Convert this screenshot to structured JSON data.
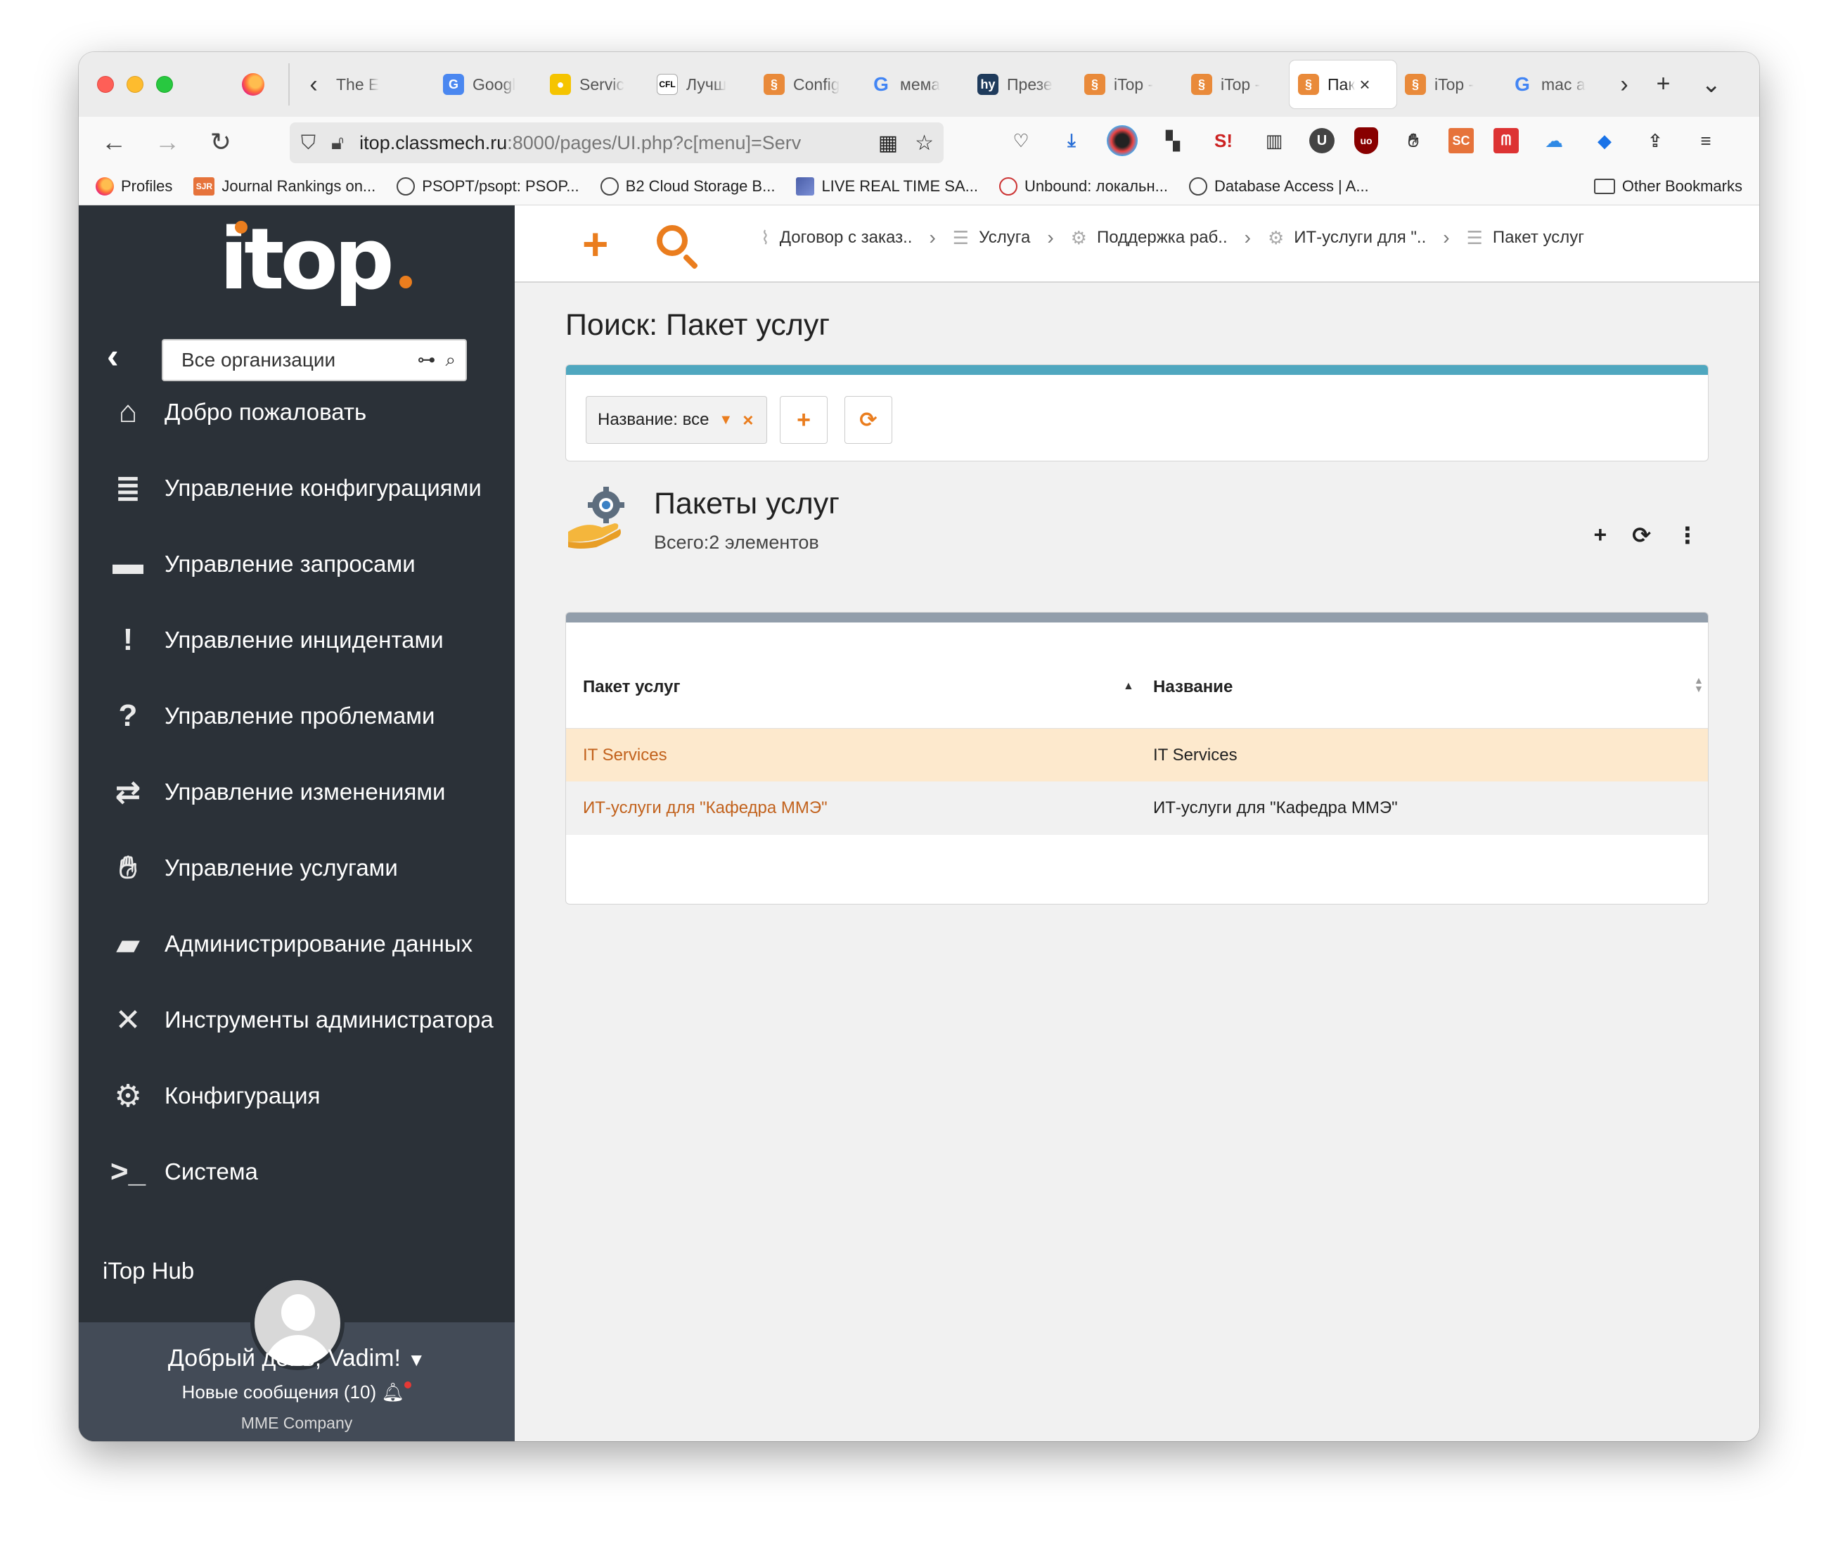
{
  "browser": {
    "tabs": [
      {
        "label": "The E",
        "icon": "text"
      },
      {
        "label": "Googl",
        "icon": "google-translate"
      },
      {
        "label": "Servic",
        "icon": "service"
      },
      {
        "label": "Лучш",
        "icon": "cfl"
      },
      {
        "label": "Config",
        "icon": "itop"
      },
      {
        "label": "мема",
        "icon": "google"
      },
      {
        "label": "Презе",
        "icon": "hy"
      },
      {
        "label": "iTop -",
        "icon": "itop"
      },
      {
        "label": "iTop -",
        "icon": "itop"
      },
      {
        "label": "Пак",
        "icon": "itop",
        "active": true
      },
      {
        "label": "iTop -",
        "icon": "itop"
      },
      {
        "label": "mac a",
        "icon": "google"
      }
    ],
    "url": {
      "host": "itop.classmech.ru",
      "rest": ":8000/pages/UI.php?c[menu]=Serv"
    },
    "bookmarks": [
      {
        "label": "Profiles",
        "icon": "firefox"
      },
      {
        "label": "Journal Rankings on...",
        "icon": "sjr"
      },
      {
        "label": "PSOPT/psopt: PSOP...",
        "icon": "globe"
      },
      {
        "label": "B2 Cloud Storage B...",
        "icon": "globe"
      },
      {
        "label": "LIVE REAL TIME SA...",
        "icon": "live"
      },
      {
        "label": "Unbound: локальн...",
        "icon": "debian"
      },
      {
        "label": "Database Access | A...",
        "icon": "globe"
      }
    ],
    "other_bookmarks": "Other Bookmarks",
    "extensions": [
      "pocket-icon",
      "download-icon",
      "camera-icon",
      "grid-icon",
      "s-icon",
      "fence-icon",
      "u-icon",
      "ublock-icon",
      "gnome-icon",
      "sc-icon",
      "mendeley-icon",
      "cloud-icon",
      "diamond-icon",
      "share-icon",
      "menu-icon"
    ],
    "sjr_text": "SJR",
    "sc_text": "SC",
    "u_text": "U",
    "s_text": "S!",
    "ub_text": "uo"
  },
  "sidebar": {
    "logo": "itop",
    "org_select": "Все организации",
    "menu": [
      {
        "label": "Добро пожаловать",
        "icon": "home-icon"
      },
      {
        "label": "Управление конфигурациями",
        "icon": "database-icon"
      },
      {
        "label": "Управление запросами",
        "icon": "comment-icon"
      },
      {
        "label": "Управление инцидентами",
        "icon": "exclamation-icon"
      },
      {
        "label": "Управление проблемами",
        "icon": "question-icon"
      },
      {
        "label": "Управление изменениями",
        "icon": "exchange-icon"
      },
      {
        "label": "Управление услугами",
        "icon": "handshake-icon"
      },
      {
        "label": "Администрирование данных",
        "icon": "folder-icon"
      },
      {
        "label": "Инструменты администратора",
        "icon": "tools-icon"
      },
      {
        "label": "Конфигурация",
        "icon": "gear-icon"
      },
      {
        "label": "Система",
        "icon": "terminal-icon"
      }
    ],
    "hidden_item": "iTop Hub",
    "user": {
      "greeting": "Добрый день, Vadim!",
      "messages": "Новые сообщения (10)",
      "company": "MME Company"
    }
  },
  "main": {
    "breadcrumb": [
      {
        "label": "Договор с заказ..",
        "icon": "contract-icon"
      },
      {
        "label": "Услуга",
        "icon": "list-icon"
      },
      {
        "label": "Поддержка раб..",
        "icon": "service-icon"
      },
      {
        "label": "ИТ-услуги для \"..",
        "icon": "service-icon"
      },
      {
        "label": "Пакет услуг",
        "icon": "list-icon"
      }
    ],
    "page_title": "Поиск: Пакет услуг",
    "search_criteria": "Название: все",
    "list": {
      "title": "Пакеты услуг",
      "count": "Всего:2 элементов",
      "columns": [
        "Пакет услуг",
        "Название"
      ],
      "rows": [
        [
          "IT Services",
          "IT Services"
        ],
        [
          "ИТ-услуги для \"Кафедра ММЭ\"",
          "ИТ-услуги для \"Кафедра ММЭ\""
        ]
      ]
    }
  },
  "colors": {
    "accent": "#ea7d1e",
    "sidebar_bg": "#2b3138",
    "search_stripe": "#4fa7bf",
    "list_stripe": "#929eab",
    "selected_row": "#fde9cd",
    "link": "#c2621d"
  }
}
